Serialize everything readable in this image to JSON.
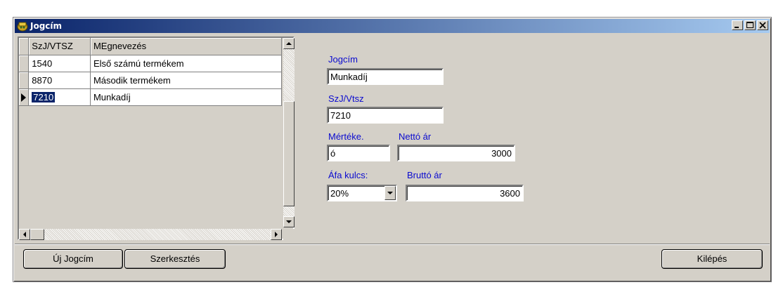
{
  "window": {
    "title": "Jogcím"
  },
  "grid": {
    "columns": [
      "SzJ/VTSZ",
      "MEgnevezés"
    ],
    "rows": [
      {
        "code": "1540",
        "name": "Első számú termékem"
      },
      {
        "code": "8870",
        "name": "Második termékem"
      },
      {
        "code": "7210",
        "name": "Munkadíj",
        "selected": true
      }
    ]
  },
  "form": {
    "jogcim_label": "Jogcím",
    "jogcim_value": "Munkadíj",
    "szj_label": "SzJ/Vtsz",
    "szj_value": "7210",
    "merteke_label": "Mértéke.",
    "merteke_value": "ó",
    "netto_label": "Nettó ár",
    "netto_value": "3000",
    "afa_label": "Áfa kulcs:",
    "afa_value": "20%",
    "brutto_label": "Bruttó ár",
    "brutto_value": "3600"
  },
  "buttons": {
    "new": "Új Jogcím",
    "edit": "Szerkesztés",
    "exit": "Kilépés"
  },
  "colors": {
    "title_start": "#0a246a",
    "title_end": "#a6caf0",
    "label_blue": "#0a0ad0",
    "face": "#d4d0c8"
  }
}
